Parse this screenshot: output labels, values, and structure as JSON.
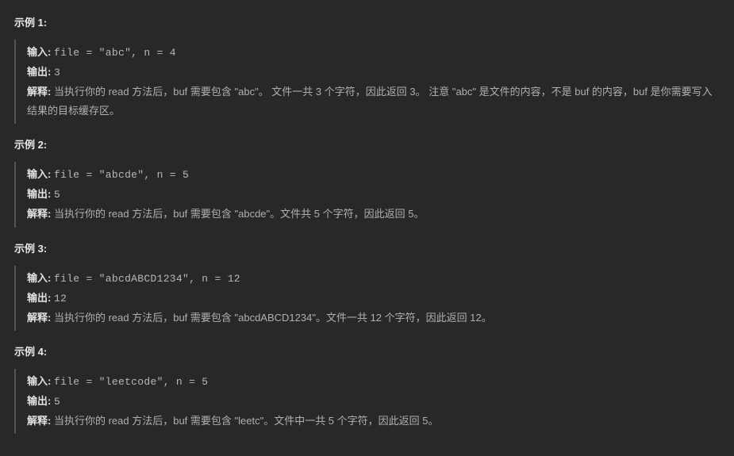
{
  "labels": {
    "input": "输入:",
    "output": "输出:",
    "explain": "解释:"
  },
  "examples": [
    {
      "title": "示例 1:",
      "input": "file = \"abc\", n = 4",
      "output": "3",
      "explain": "当执行你的 read 方法后，buf 需要包含 \"abc\"。 文件一共 3 个字符，因此返回 3。 注意 \"abc\" 是文件的内容，不是 buf 的内容，buf 是你需要写入结果的目标缓存区。"
    },
    {
      "title": "示例 2:",
      "input": "file = \"abcde\", n = 5",
      "output": "5",
      "explain": "当执行你的 read 方法后，buf 需要包含 \"abcde\"。文件共 5 个字符，因此返回 5。"
    },
    {
      "title": "示例 3:",
      "input": "file = \"abcdABCD1234\", n = 12",
      "output": "12",
      "explain": "当执行你的 read 方法后，buf 需要包含 \"abcdABCD1234\"。文件一共 12 个字符，因此返回 12。"
    },
    {
      "title": "示例 4:",
      "input": "file = \"leetcode\", n = 5",
      "output": "5",
      "explain": "当执行你的 read 方法后，buf 需要包含 \"leetc\"。文件中一共 5 个字符，因此返回 5。"
    }
  ]
}
